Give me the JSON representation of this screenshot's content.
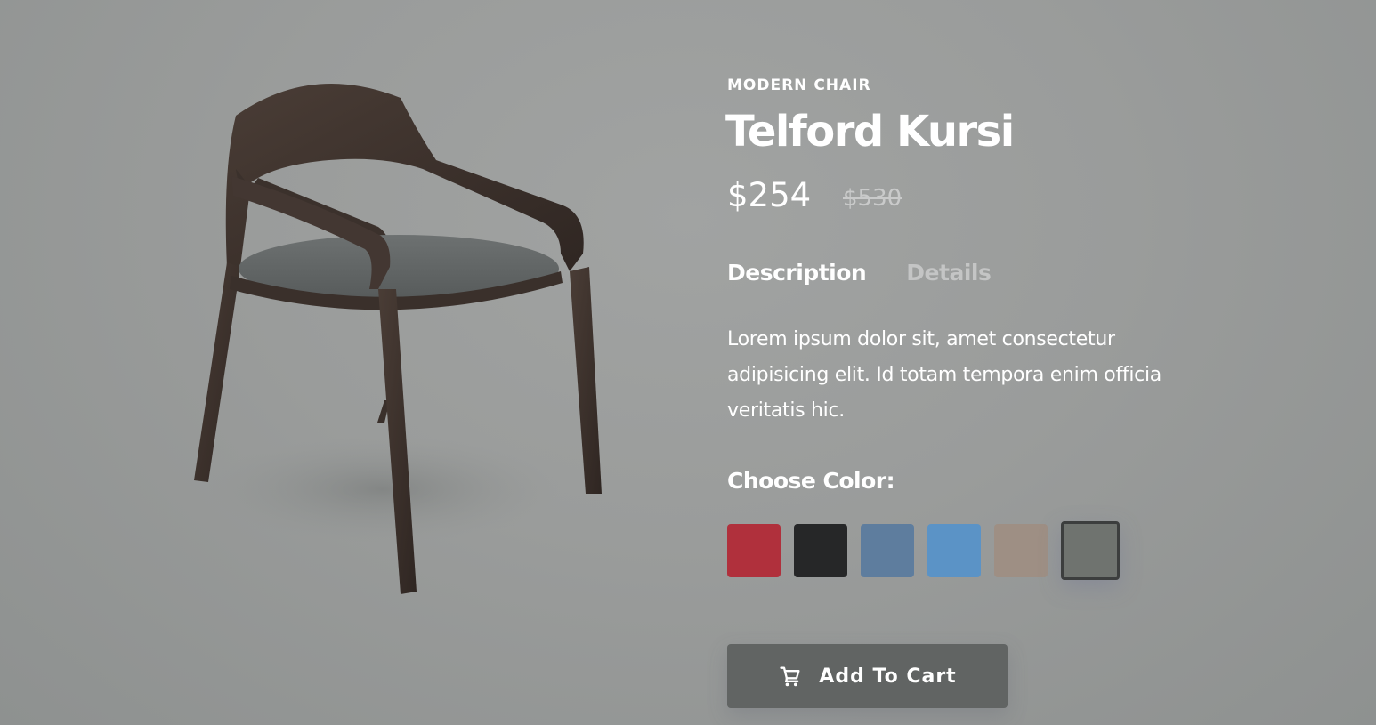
{
  "product": {
    "category": "MODERN CHAIR",
    "name": "Telford Kursi",
    "price": "$254",
    "old_price": "$530",
    "image_icon": "chair-image"
  },
  "tabs": [
    {
      "label": "Description",
      "active": true
    },
    {
      "label": "Details",
      "active": false
    }
  ],
  "description": "Lorem ipsum dolor sit, amet consectetur adipisicing elit. Id totam tempora enim officia veritatis hic.",
  "colors": {
    "label": "Choose Color:",
    "swatches": [
      {
        "name": "red",
        "color": "#b0303c"
      },
      {
        "name": "black",
        "color": "#262728"
      },
      {
        "name": "denim",
        "color": "#5e7d9e"
      },
      {
        "name": "light-blue",
        "color": "#5b93c6"
      },
      {
        "name": "beige",
        "color": "#9e8f84"
      },
      {
        "name": "gray",
        "color": "#6f736f"
      }
    ],
    "selected": "gray"
  },
  "cart": {
    "label": "Add To Cart",
    "icon": "cart-icon"
  }
}
